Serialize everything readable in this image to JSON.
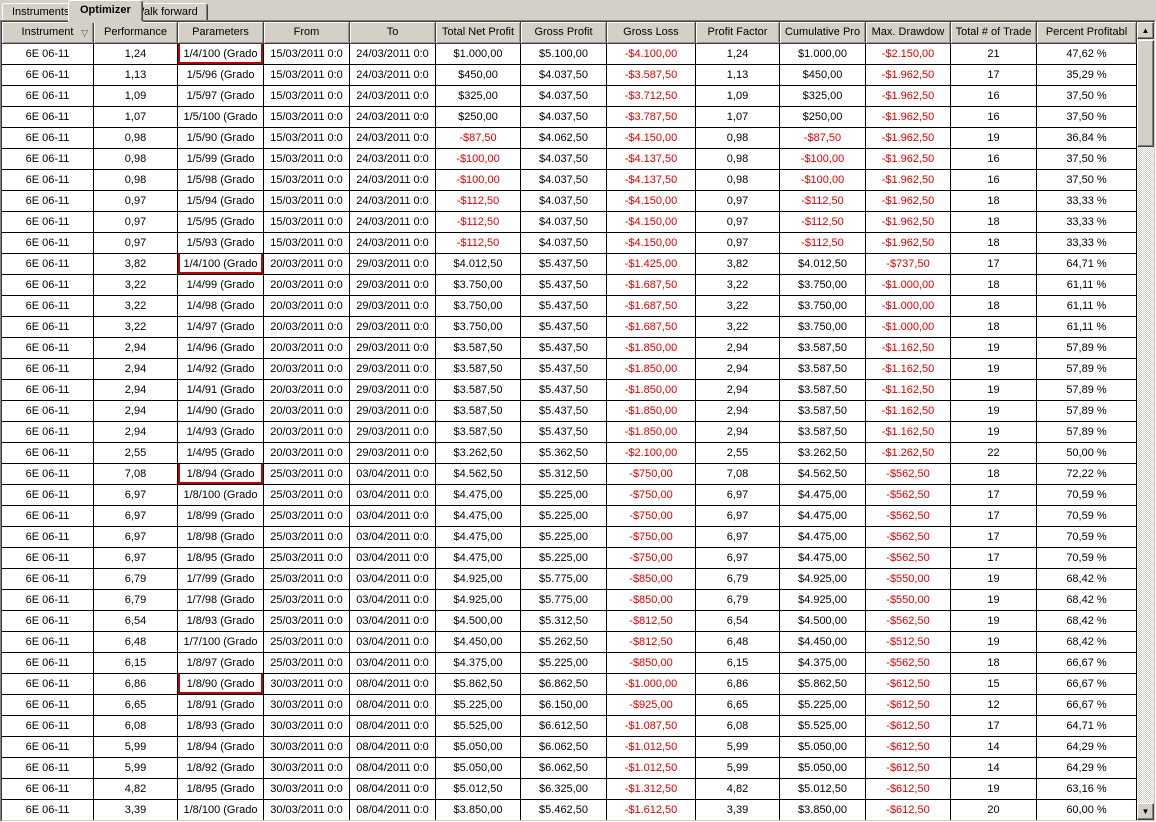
{
  "tabs": [
    {
      "label": "Instruments",
      "active": false
    },
    {
      "label": "Optimizer",
      "active": true
    },
    {
      "label": "Walk forward",
      "active": false
    }
  ],
  "icons": {
    "sort_indicator": "▽",
    "scroll_up": "▲",
    "scroll_down": "▼"
  },
  "colors": {
    "negative_value": "#dd0000",
    "annotation_box": "#b40808",
    "chrome": "#d4d0c8"
  },
  "table": {
    "columns": [
      {
        "label": "Instrument",
        "sort_icon": "descending-outline"
      },
      {
        "label": "Performance"
      },
      {
        "label": "Parameters"
      },
      {
        "label": "From"
      },
      {
        "label": "To"
      },
      {
        "label": "Total Net Profit"
      },
      {
        "label": "Gross Profit"
      },
      {
        "label": "Gross Loss"
      },
      {
        "label": "Profit Factor"
      },
      {
        "label": "Cumulative Pro"
      },
      {
        "label": "Max. Drawdow"
      },
      {
        "label": "Total # of Trade"
      },
      {
        "label": "Percent Profitabl"
      }
    ],
    "annotated_row_indices": [
      0,
      10,
      20,
      30
    ],
    "annotated_column_index": 2,
    "rows": [
      [
        "6E 06-11",
        "1,24",
        "1/4/100 (Grado",
        "15/03/2011 0:0",
        "24/03/2011 0:0",
        "$1.000,00",
        "$5.100,00",
        "-$4.100,00",
        "1,24",
        "$1.000,00",
        "-$2.150,00",
        "21",
        "47,62 %"
      ],
      [
        "6E 06-11",
        "1,13",
        "1/5/96 (Grado",
        "15/03/2011 0:0",
        "24/03/2011 0:0",
        "$450,00",
        "$4.037,50",
        "-$3.587,50",
        "1,13",
        "$450,00",
        "-$1.962,50",
        "17",
        "35,29 %"
      ],
      [
        "6E 06-11",
        "1,09",
        "1/5/97 (Grado",
        "15/03/2011 0:0",
        "24/03/2011 0:0",
        "$325,00",
        "$4.037,50",
        "-$3.712,50",
        "1,09",
        "$325,00",
        "-$1.962,50",
        "16",
        "37,50 %"
      ],
      [
        "6E 06-11",
        "1,07",
        "1/5/100 (Grado",
        "15/03/2011 0:0",
        "24/03/2011 0:0",
        "$250,00",
        "$4.037,50",
        "-$3.787,50",
        "1,07",
        "$250,00",
        "-$1.962,50",
        "16",
        "37,50 %"
      ],
      [
        "6E 06-11",
        "0,98",
        "1/5/90 (Grado",
        "15/03/2011 0:0",
        "24/03/2011 0:0",
        "-$87,50",
        "$4.062,50",
        "-$4.150,00",
        "0,98",
        "-$87,50",
        "-$1.962,50",
        "19",
        "36,84 %"
      ],
      [
        "6E 06-11",
        "0,98",
        "1/5/99 (Grado",
        "15/03/2011 0:0",
        "24/03/2011 0:0",
        "-$100,00",
        "$4.037,50",
        "-$4.137,50",
        "0,98",
        "-$100,00",
        "-$1.962,50",
        "16",
        "37,50 %"
      ],
      [
        "6E 06-11",
        "0,98",
        "1/5/98 (Grado",
        "15/03/2011 0:0",
        "24/03/2011 0:0",
        "-$100,00",
        "$4.037,50",
        "-$4.137,50",
        "0,98",
        "-$100,00",
        "-$1.962,50",
        "16",
        "37,50 %"
      ],
      [
        "6E 06-11",
        "0,97",
        "1/5/94 (Grado",
        "15/03/2011 0:0",
        "24/03/2011 0:0",
        "-$112,50",
        "$4.037,50",
        "-$4.150,00",
        "0,97",
        "-$112,50",
        "-$1.962,50",
        "18",
        "33,33 %"
      ],
      [
        "6E 06-11",
        "0,97",
        "1/5/95 (Grado",
        "15/03/2011 0:0",
        "24/03/2011 0:0",
        "-$112,50",
        "$4.037,50",
        "-$4.150,00",
        "0,97",
        "-$112,50",
        "-$1.962,50",
        "18",
        "33,33 %"
      ],
      [
        "6E 06-11",
        "0,97",
        "1/5/93 (Grado",
        "15/03/2011 0:0",
        "24/03/2011 0:0",
        "-$112,50",
        "$4.037,50",
        "-$4.150,00",
        "0,97",
        "-$112,50",
        "-$1.962,50",
        "18",
        "33,33 %"
      ],
      [
        "6E 06-11",
        "3,82",
        "1/4/100 (Grado",
        "20/03/2011 0:0",
        "29/03/2011 0:0",
        "$4.012,50",
        "$5.437,50",
        "-$1.425,00",
        "3,82",
        "$4.012,50",
        "-$737,50",
        "17",
        "64,71 %"
      ],
      [
        "6E 06-11",
        "3,22",
        "1/4/99 (Grado",
        "20/03/2011 0:0",
        "29/03/2011 0:0",
        "$3.750,00",
        "$5.437,50",
        "-$1.687,50",
        "3,22",
        "$3.750,00",
        "-$1.000,00",
        "18",
        "61,11 %"
      ],
      [
        "6E 06-11",
        "3,22",
        "1/4/98 (Grado",
        "20/03/2011 0:0",
        "29/03/2011 0:0",
        "$3.750,00",
        "$5.437,50",
        "-$1.687,50",
        "3,22",
        "$3.750,00",
        "-$1.000,00",
        "18",
        "61,11 %"
      ],
      [
        "6E 06-11",
        "3,22",
        "1/4/97 (Grado",
        "20/03/2011 0:0",
        "29/03/2011 0:0",
        "$3.750,00",
        "$5.437,50",
        "-$1.687,50",
        "3,22",
        "$3.750,00",
        "-$1.000,00",
        "18",
        "61,11 %"
      ],
      [
        "6E 06-11",
        "2,94",
        "1/4/96 (Grado",
        "20/03/2011 0:0",
        "29/03/2011 0:0",
        "$3.587,50",
        "$5.437,50",
        "-$1.850,00",
        "2,94",
        "$3.587,50",
        "-$1.162,50",
        "19",
        "57,89 %"
      ],
      [
        "6E 06-11",
        "2,94",
        "1/4/92 (Grado",
        "20/03/2011 0:0",
        "29/03/2011 0:0",
        "$3.587,50",
        "$5.437,50",
        "-$1.850,00",
        "2,94",
        "$3.587,50",
        "-$1.162,50",
        "19",
        "57,89 %"
      ],
      [
        "6E 06-11",
        "2,94",
        "1/4/91 (Grado",
        "20/03/2011 0:0",
        "29/03/2011 0:0",
        "$3.587,50",
        "$5.437,50",
        "-$1.850,00",
        "2,94",
        "$3.587,50",
        "-$1.162,50",
        "19",
        "57,89 %"
      ],
      [
        "6E 06-11",
        "2,94",
        "1/4/90 (Grado",
        "20/03/2011 0:0",
        "29/03/2011 0:0",
        "$3.587,50",
        "$5.437,50",
        "-$1.850,00",
        "2,94",
        "$3.587,50",
        "-$1.162,50",
        "19",
        "57,89 %"
      ],
      [
        "6E 06-11",
        "2,94",
        "1/4/93 (Grado",
        "20/03/2011 0:0",
        "29/03/2011 0:0",
        "$3.587,50",
        "$5.437,50",
        "-$1.850,00",
        "2,94",
        "$3.587,50",
        "-$1.162,50",
        "19",
        "57,89 %"
      ],
      [
        "6E 06-11",
        "2,55",
        "1/4/95 (Grado",
        "20/03/2011 0:0",
        "29/03/2011 0:0",
        "$3.262,50",
        "$5.362,50",
        "-$2.100,00",
        "2,55",
        "$3.262,50",
        "-$1.262,50",
        "22",
        "50,00 %"
      ],
      [
        "6E 06-11",
        "7,08",
        "1/8/94 (Grado",
        "25/03/2011 0:0",
        "03/04/2011 0:0",
        "$4.562,50",
        "$5.312,50",
        "-$750,00",
        "7,08",
        "$4.562,50",
        "-$562,50",
        "18",
        "72,22 %"
      ],
      [
        "6E 06-11",
        "6,97",
        "1/8/100 (Grado",
        "25/03/2011 0:0",
        "03/04/2011 0:0",
        "$4.475,00",
        "$5.225,00",
        "-$750,00",
        "6,97",
        "$4.475,00",
        "-$562,50",
        "17",
        "70,59 %"
      ],
      [
        "6E 06-11",
        "6,97",
        "1/8/99 (Grado",
        "25/03/2011 0:0",
        "03/04/2011 0:0",
        "$4.475,00",
        "$5.225,00",
        "-$750,00",
        "6,97",
        "$4.475,00",
        "-$562,50",
        "17",
        "70,59 %"
      ],
      [
        "6E 06-11",
        "6,97",
        "1/8/98 (Grado",
        "25/03/2011 0:0",
        "03/04/2011 0:0",
        "$4.475,00",
        "$5.225,00",
        "-$750,00",
        "6,97",
        "$4.475,00",
        "-$562,50",
        "17",
        "70,59 %"
      ],
      [
        "6E 06-11",
        "6,97",
        "1/8/95 (Grado",
        "25/03/2011 0:0",
        "03/04/2011 0:0",
        "$4.475,00",
        "$5.225,00",
        "-$750,00",
        "6,97",
        "$4.475,00",
        "-$562,50",
        "17",
        "70,59 %"
      ],
      [
        "6E 06-11",
        "6,79",
        "1/7/99 (Grado",
        "25/03/2011 0:0",
        "03/04/2011 0:0",
        "$4.925,00",
        "$5.775,00",
        "-$850,00",
        "6,79",
        "$4.925,00",
        "-$550,00",
        "19",
        "68,42 %"
      ],
      [
        "6E 06-11",
        "6,79",
        "1/7/98 (Grado",
        "25/03/2011 0:0",
        "03/04/2011 0:0",
        "$4.925,00",
        "$5.775,00",
        "-$850,00",
        "6,79",
        "$4.925,00",
        "-$550,00",
        "19",
        "68,42 %"
      ],
      [
        "6E 06-11",
        "6,54",
        "1/8/93 (Grado",
        "25/03/2011 0:0",
        "03/04/2011 0:0",
        "$4.500,00",
        "$5.312,50",
        "-$812,50",
        "6,54",
        "$4.500,00",
        "-$562,50",
        "19",
        "68,42 %"
      ],
      [
        "6E 06-11",
        "6,48",
        "1/7/100 (Grado",
        "25/03/2011 0:0",
        "03/04/2011 0:0",
        "$4.450,00",
        "$5.262,50",
        "-$812,50",
        "6,48",
        "$4.450,00",
        "-$512,50",
        "19",
        "68,42 %"
      ],
      [
        "6E 06-11",
        "6,15",
        "1/8/97 (Grado",
        "25/03/2011 0:0",
        "03/04/2011 0:0",
        "$4.375,00",
        "$5.225,00",
        "-$850,00",
        "6,15",
        "$4.375,00",
        "-$562,50",
        "18",
        "66,67 %"
      ],
      [
        "6E 06-11",
        "6,86",
        "1/8/90 (Grado",
        "30/03/2011 0:0",
        "08/04/2011 0:0",
        "$5.862,50",
        "$6.862,50",
        "-$1.000,00",
        "6,86",
        "$5.862,50",
        "-$612,50",
        "15",
        "66,67 %"
      ],
      [
        "6E 06-11",
        "6,65",
        "1/8/91 (Grado",
        "30/03/2011 0:0",
        "08/04/2011 0:0",
        "$5.225,00",
        "$6.150,00",
        "-$925,00",
        "6,65",
        "$5.225,00",
        "-$612,50",
        "12",
        "66,67 %"
      ],
      [
        "6E 06-11",
        "6,08",
        "1/8/93 (Grado",
        "30/03/2011 0:0",
        "08/04/2011 0:0",
        "$5.525,00",
        "$6.612,50",
        "-$1.087,50",
        "6,08",
        "$5.525,00",
        "-$612,50",
        "17",
        "64,71 %"
      ],
      [
        "6E 06-11",
        "5,99",
        "1/8/94 (Grado",
        "30/03/2011 0:0",
        "08/04/2011 0:0",
        "$5.050,00",
        "$6.062,50",
        "-$1.012,50",
        "5,99",
        "$5.050,00",
        "-$612,50",
        "14",
        "64,29 %"
      ],
      [
        "6E 06-11",
        "5,99",
        "1/8/92 (Grado",
        "30/03/2011 0:0",
        "08/04/2011 0:0",
        "$5.050,00",
        "$6.062,50",
        "-$1.012,50",
        "5,99",
        "$5.050,00",
        "-$612,50",
        "14",
        "64,29 %"
      ],
      [
        "6E 06-11",
        "4,82",
        "1/8/95 (Grado",
        "30/03/2011 0:0",
        "08/04/2011 0:0",
        "$5.012,50",
        "$6.325,00",
        "-$1.312,50",
        "4,82",
        "$5.012,50",
        "-$612,50",
        "19",
        "63,16 %"
      ],
      [
        "6E 06-11",
        "3,39",
        "1/8/100 (Grado",
        "30/03/2011 0:0",
        "08/04/2011 0:0",
        "$3.850,00",
        "$5.462,50",
        "-$1.612,50",
        "3,39",
        "$3.850,00",
        "-$612,50",
        "20",
        "60,00 %"
      ]
    ]
  }
}
